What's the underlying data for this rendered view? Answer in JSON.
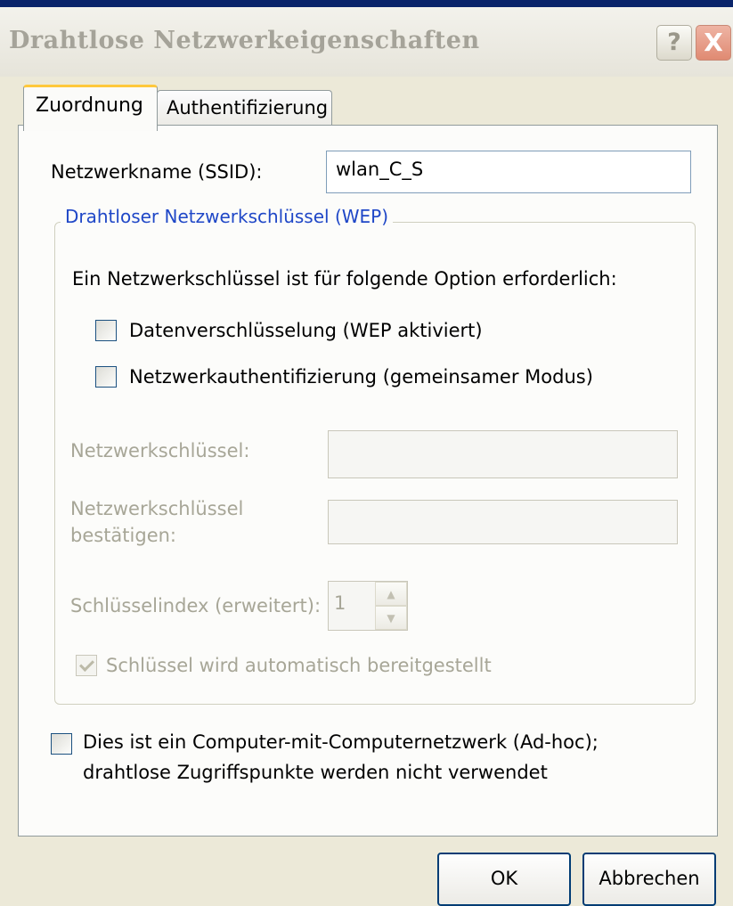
{
  "window": {
    "title": "Drahtlose Netzwerkeigenschaften",
    "help_label": "?",
    "close_label": "X"
  },
  "tabs": [
    {
      "label": "Zuordnung",
      "active": true
    },
    {
      "label": "Authentifizierung",
      "active": false
    }
  ],
  "ssid": {
    "label": "Netzwerkname (SSID):",
    "value": "wlan_C_S"
  },
  "wep_group": {
    "legend": "Drahtloser Netzwerkschlüssel (WEP)",
    "description": "Ein Netzwerkschlüssel ist für folgende Option erforderlich:",
    "options": [
      {
        "label": "Datenverschlüsselung (WEP aktiviert)",
        "checked": false
      },
      {
        "label": "Netzwerkauthentifizierung (gemeinsamer Modus)",
        "checked": false
      }
    ],
    "key_label": "Netzwerkschlüssel:",
    "key_value": "",
    "confirm_label_line1": "Netzwerkschlüssel",
    "confirm_label_line2": "bestätigen:",
    "confirm_value": "",
    "index_label": "Schlüsselindex (erweitert):",
    "index_value": "1",
    "auto_label": "Schlüssel wird automatisch bereitgestellt",
    "auto_checked": true,
    "auto_disabled": true
  },
  "adhoc": {
    "line1": "Dies ist ein Computer-mit-Computernetzwerk (Ad-hoc);",
    "line2": "drahtlose Zugriffspunkte werden nicht verwendet",
    "checked": false
  },
  "buttons": {
    "ok": "OK",
    "cancel": "Abbrechen"
  },
  "colors": {
    "group_legend": "#1f47c7",
    "disabled_text": "#a7a697",
    "active_tab_accent": "#ffc83c"
  }
}
